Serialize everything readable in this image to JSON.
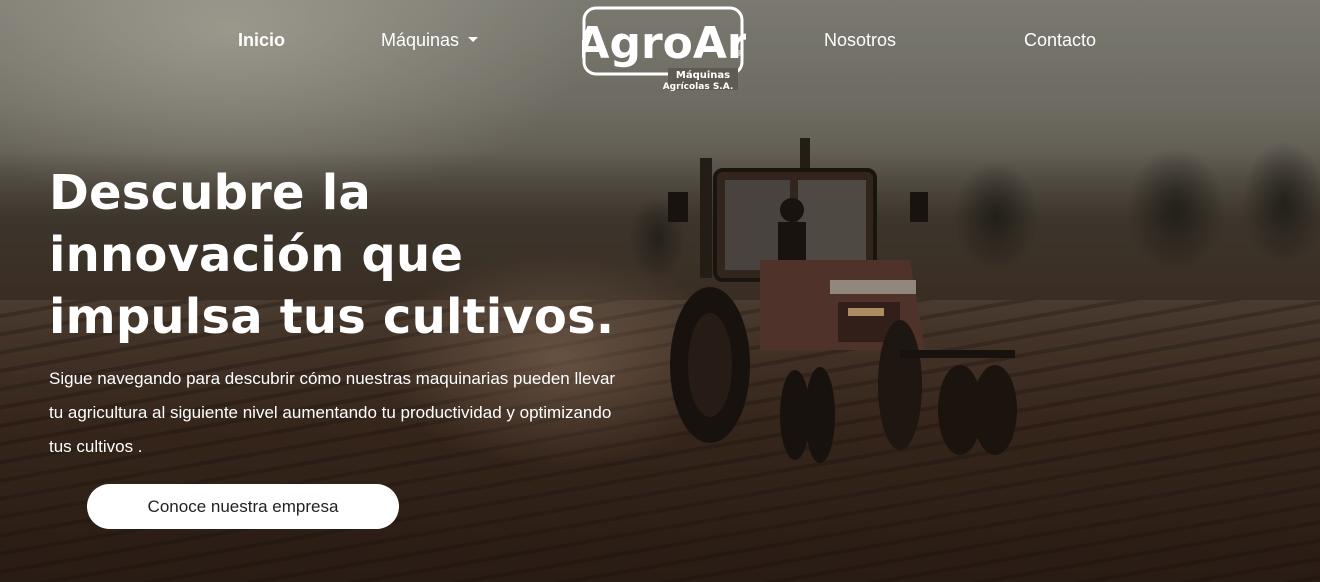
{
  "nav": {
    "items": [
      {
        "label": "Inicio",
        "active": true
      },
      {
        "label": "Máquinas",
        "dropdown": true
      },
      {
        "label": "Nosotros"
      },
      {
        "label": "Contacto"
      }
    ],
    "logo": {
      "brand": "AgroAr",
      "registered": "®",
      "subtitle_line1": "Máquinas",
      "subtitle_line2": "Agrícolas S.A."
    }
  },
  "hero": {
    "title": "Descubre la innovación que impulsa tus cultivos.",
    "description": "Sigue navegando para descubrir cómo nuestras maquinarias pueden llevar tu agricultura al siguiente nivel aumentando tu productividad y optimizando tus cultivos .",
    "cta_label": "Conoce nuestra empresa"
  },
  "colors": {
    "text": "#ffffff",
    "button_bg": "#ffffff",
    "button_text": "#222222"
  }
}
